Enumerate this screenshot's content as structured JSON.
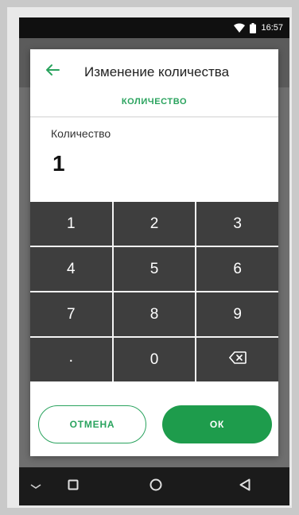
{
  "status_bar": {
    "time": "16:57",
    "icons": [
      "wifi-icon",
      "battery-icon"
    ]
  },
  "dialog": {
    "title": "Изменение количества",
    "tab_label": "КОЛИЧЕСТВО",
    "field_label": "Количество",
    "field_value": "1",
    "back_icon": "arrow-left-icon"
  },
  "keypad": {
    "keys": [
      "1",
      "2",
      "3",
      "4",
      "5",
      "6",
      "7",
      "8",
      "9",
      ".",
      "0"
    ],
    "backspace_icon": "backspace-icon"
  },
  "buttons": {
    "cancel_label": "ОТМЕНА",
    "ok_label": "ОК"
  },
  "nav_bar": {
    "icons": [
      "keyboard-hide-icon",
      "recents-icon",
      "home-icon",
      "back-icon"
    ]
  },
  "colors": {
    "accent": "#1e9c4c",
    "keypad_key": "#3e3e3e",
    "dialog_bg": "#ffffff"
  }
}
